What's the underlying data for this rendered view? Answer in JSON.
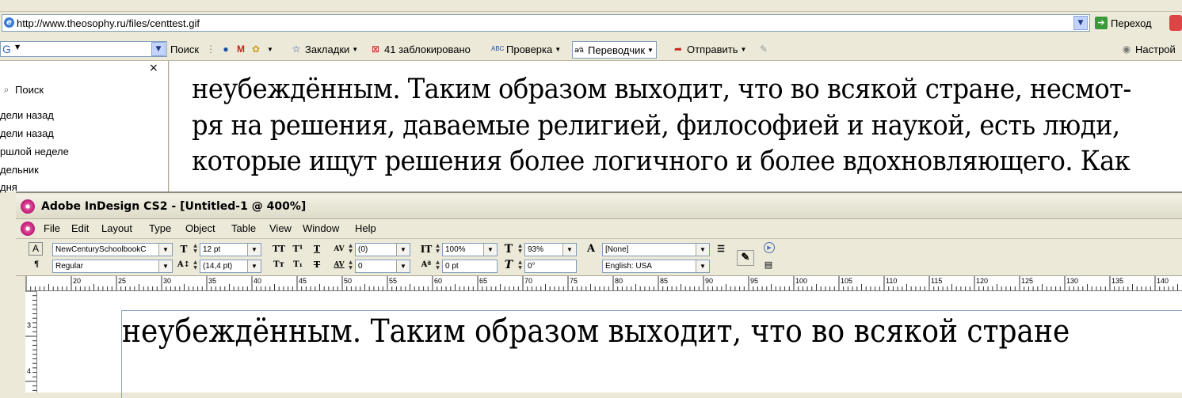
{
  "browser": {
    "address": "http://www.theosophy.ru/files/centtest.gif",
    "go_label": "Переход",
    "toolbar": {
      "google_value": "G",
      "search_label": "Поиск",
      "bookmarks_label": "Закладки",
      "blocked_label": "41 заблокировано",
      "check_label": "Проверка",
      "translator_label": "Переводчик",
      "send_label": "Отправить",
      "settings_label": "Настрой"
    },
    "sidebar": {
      "close_glyph": "×",
      "search_label": "Поиск",
      "items": [
        "дели назад",
        "дели назад",
        "ршлой неделе",
        "дельник",
        "дня"
      ]
    },
    "content_lines": [
      "неубеждённым. Таким образом выходит, что во всякой стране, несмот-",
      "ря на решения, даваемые религией, философией и наукой, есть люди,",
      "которые ищут решения более логичного и более вдохновляющего. Как"
    ]
  },
  "indesign": {
    "title": "Adobe InDesign CS2 - [Untitled-1 @ 400%]",
    "menu": [
      "File",
      "Edit",
      "Layout",
      "Type",
      "Object",
      "Table",
      "View",
      "Window",
      "Help"
    ],
    "control": {
      "font_family": "NewCenturySchoolbookC",
      "font_style": "Regular",
      "font_size": "12 pt",
      "leading": "(14,4 pt)",
      "kerning": "(0)",
      "tracking": "0",
      "vert_scale": "100%",
      "horiz_scale": "93%",
      "baseline_shift": "0 pt",
      "skew": "0°",
      "char_style": "[None]",
      "language": "English: USA"
    },
    "ruler_h": [
      "20",
      "25",
      "30",
      "35",
      "40",
      "45",
      "50",
      "55",
      "60",
      "65",
      "70",
      "75",
      "80",
      "85",
      "90",
      "95",
      "100",
      "105",
      "110",
      "115",
      "120",
      "125",
      "130",
      "135",
      "140"
    ],
    "ruler_v": [
      "3",
      "4"
    ],
    "page_text": "неубеждённым. Таким образом выходит, что во всякой стране"
  },
  "colors": {
    "chrome": "#ece9d8",
    "field_border": "#7f9db9",
    "frame_border": "#8fa2c4"
  }
}
